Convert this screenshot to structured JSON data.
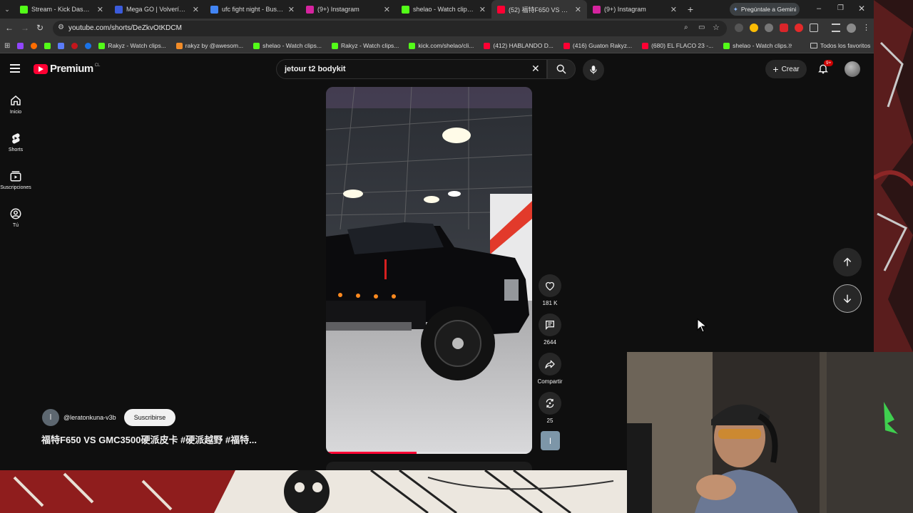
{
  "browser": {
    "tabs": [
      {
        "title": "Stream - Kick Dashboard",
        "color": "#53fc18"
      },
      {
        "title": "Mega GO | Volverías con t...",
        "color": "#3b5bdb"
      },
      {
        "title": "ufc fight night - Buscar co...",
        "color": "#4285f4"
      },
      {
        "title": "(9+) Instagram",
        "color": "#d6249f"
      },
      {
        "title": "shelao - Watch clips on Ki...",
        "color": "#53fc18"
      },
      {
        "title": "(52) 福特F650 VS GMC350...",
        "color": "#ff0033"
      },
      {
        "title": "(9+) Instagram",
        "color": "#d6249f"
      }
    ],
    "gemini_label": "Pregúntale a Gemini",
    "url": "youtube.com/shorts/DeZkvOtKDCM",
    "bookmarks": [
      {
        "title": "Rakyz - Watch clips...",
        "color": "#53fc18"
      },
      {
        "title": "rakyz by @awesom...",
        "color": "#f28c28"
      },
      {
        "title": "shelao - Watch clips...",
        "color": "#53fc18"
      },
      {
        "title": "Rakyz - Watch clips...",
        "color": "#53fc18"
      },
      {
        "title": "kick.com/shelao/cli...",
        "color": "#53fc18"
      },
      {
        "title": "(412) HABLANDO D...",
        "color": "#ff0033"
      },
      {
        "title": "(416) Guaton Rakyz...",
        "color": "#ff0033"
      },
      {
        "title": "(680) EL FLACO 23 -...",
        "color": "#ff0033"
      },
      {
        "title": "shelao - Watch clips...",
        "color": "#53fc18"
      }
    ],
    "favorites_label": "Todos los favoritos"
  },
  "youtube": {
    "logo_text": "Premium",
    "logo_region": "CL",
    "search_query": "jetour t2 bodykit",
    "create_label": "Crear",
    "notifications_badge": "9+",
    "guide": [
      {
        "label": "Inicio",
        "icon": "home-icon"
      },
      {
        "label": "Shorts",
        "icon": "shorts-icon"
      },
      {
        "label": "Suscripciones",
        "icon": "subscriptions-icon"
      },
      {
        "label": "Tú",
        "icon": "you-icon"
      }
    ],
    "short": {
      "channel_handle": "@leratonkuna-v3b",
      "channel_avatar_letter": "l",
      "subscribe_label": "Suscribirse",
      "title": "福特F650 VS GMC3500硬派皮卡 #硬派越野 #福特...",
      "likes": "181 K",
      "comments": "2644",
      "share_label": "Compartir",
      "remix_count": "25",
      "progress_fraction": 0.44
    }
  },
  "colors": {
    "youtube_red": "#ff0033",
    "kick_green": "#53fc18",
    "bg": "#0f0f0f"
  }
}
